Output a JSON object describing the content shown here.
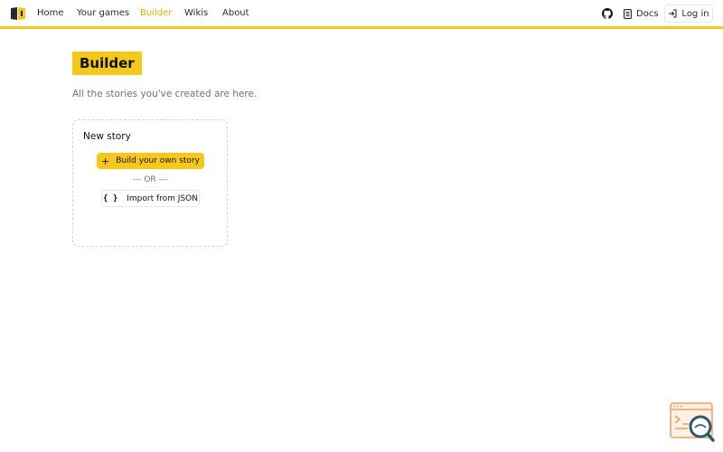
{
  "nav": {
    "links": [
      {
        "label": "Home"
      },
      {
        "label": "Your games"
      },
      {
        "label": "Builder",
        "active": true
      },
      {
        "label": "Wikis"
      },
      {
        "label": "About"
      }
    ],
    "docs_label": "Docs",
    "login_label": "Log in",
    "accent_color": "#f6c81a"
  },
  "page": {
    "title": "Builder",
    "subtitle": "All the stories you've created are here."
  },
  "new_story_card": {
    "title": "New story",
    "build_button": {
      "icon": "+",
      "label": "Build your own story"
    },
    "separator": "--- OR ---",
    "import_button": {
      "icon": "{ }",
      "label": "Import from JSON"
    }
  },
  "icons": {
    "logo": "book-logo-icon",
    "github": "github-icon",
    "docs": "document-icon",
    "login": "login-arrow-icon",
    "widget": "code-search-icon"
  }
}
